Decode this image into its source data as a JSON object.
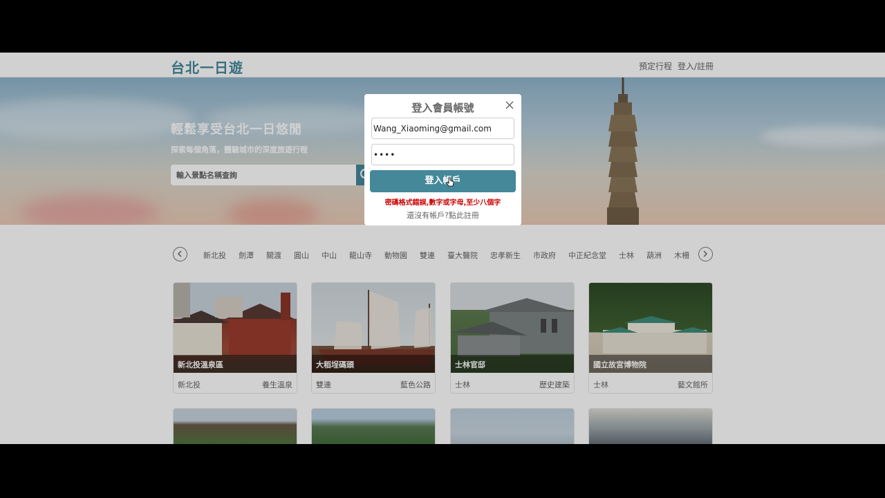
{
  "header": {
    "title": "台北一日遊",
    "nav": {
      "schedule": "預定行程",
      "login": "登入/註冊"
    }
  },
  "hero": {
    "title": "輕鬆享受台北一日悠閒",
    "subtitle": "探索每個角落，體驗城市的深度旅遊行程",
    "search_placeholder": "輸入景點名稱查詢"
  },
  "categories": [
    "新北投",
    "劍潭",
    "關渡",
    "圓山",
    "中山",
    "龍山寺",
    "動物園",
    "雙連",
    "臺大醫院",
    "忠孝新生",
    "市政府",
    "中正紀念堂",
    "士林",
    "葫洲",
    "木柵"
  ],
  "attractions": [
    {
      "name": "新北投溫泉區",
      "mrt": "新北投",
      "category": "養生溫泉"
    },
    {
      "name": "大稻埕碼頭",
      "mrt": "雙連",
      "category": "藍色公路"
    },
    {
      "name": "士林官邸",
      "mrt": "士林",
      "category": "歷史建築"
    },
    {
      "name": "國立故宮博物院",
      "mrt": "士林",
      "category": "藝文館所"
    }
  ],
  "login_modal": {
    "title": "登入會員帳號",
    "email_value": "Wang_Xiaoming@gmail.com",
    "password_value": "••••",
    "button_label": "登入帳戶",
    "error": "密碼格式錯誤,數字或字母,至少八個字",
    "register_prompt": "還沒有帳戶?點此註冊"
  },
  "colors": {
    "brand": "#448899",
    "error": "#cc0000"
  }
}
